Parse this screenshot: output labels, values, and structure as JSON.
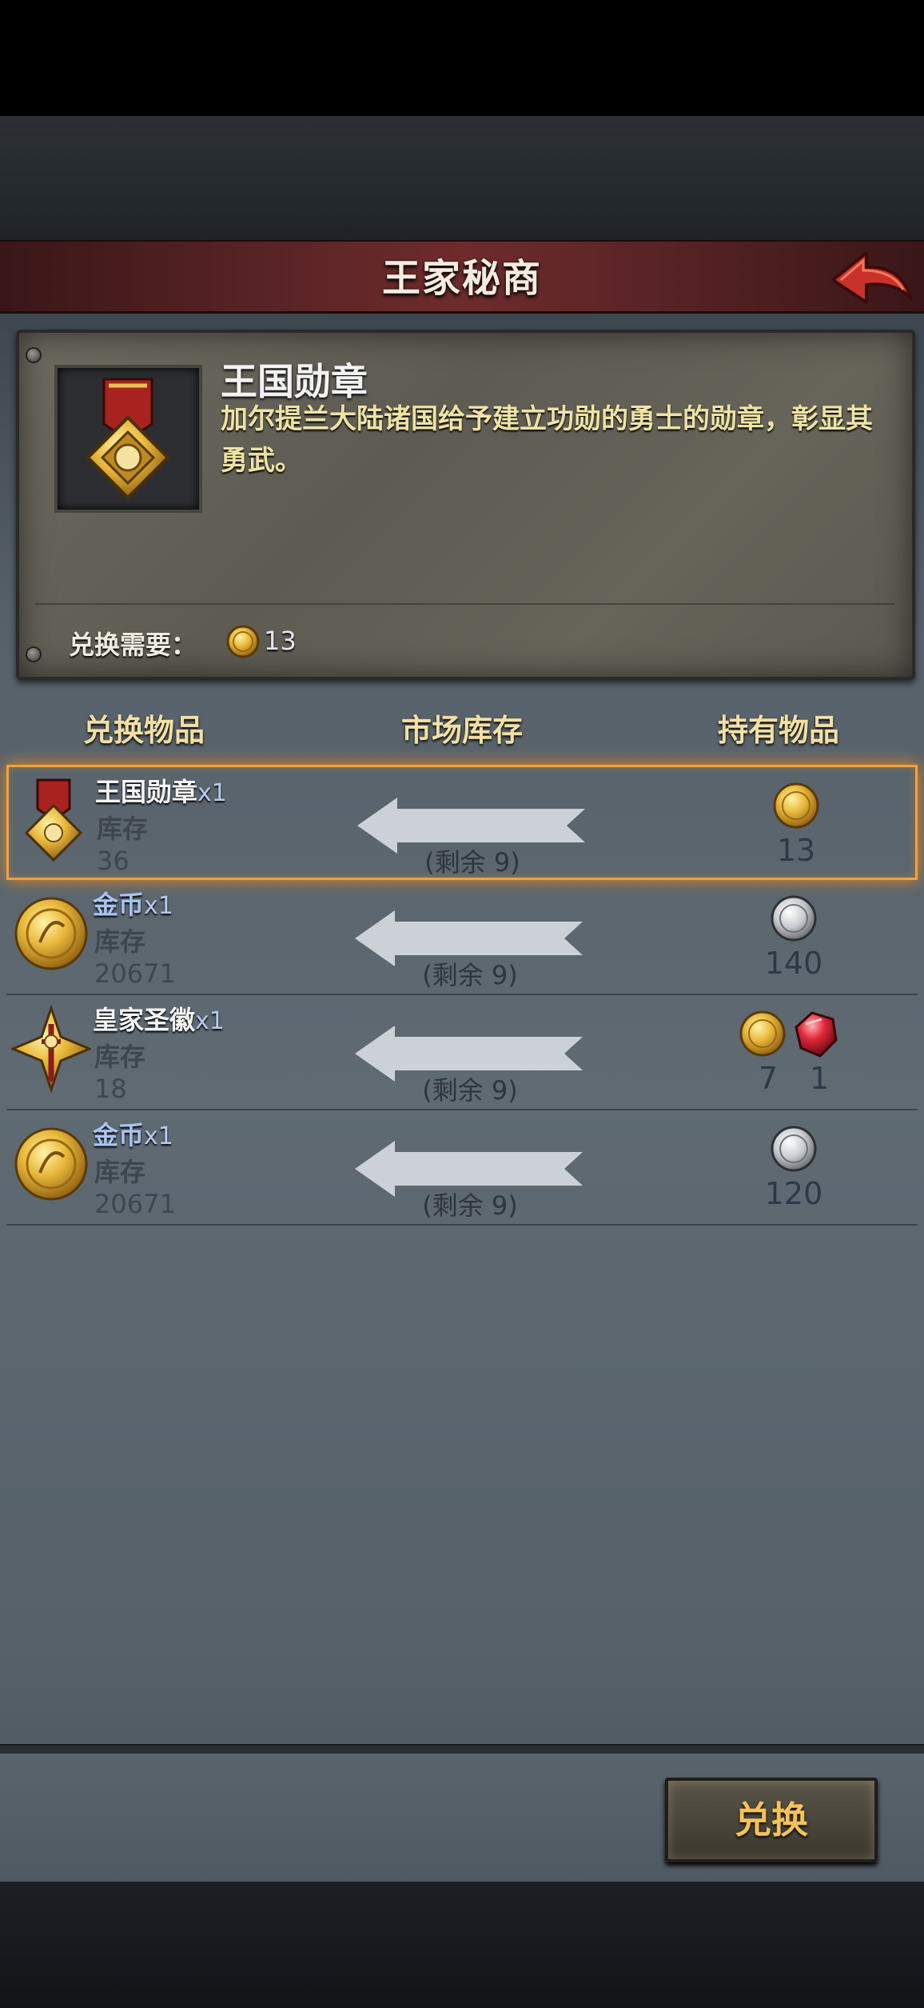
{
  "header": {
    "title": "王家秘商"
  },
  "item_detail": {
    "name": "王国勋章",
    "description": "加尔提兰大陆诸国给予建立功勋的勇士的勋章，彰显其勇武。",
    "cost_label": "兑换需要：",
    "cost_value": "13",
    "cost_icon": "gold-coin-icon"
  },
  "columns": {
    "exchange_item": "兑换物品",
    "market_stock": "市场库存",
    "owned_items": "持有物品"
  },
  "rows": [
    {
      "name": "王国勋章",
      "qty": "x1",
      "stock_label": "库存",
      "stock": "36",
      "remaining": "(剩余 9)",
      "owned": [
        "13"
      ],
      "icon": "medal-icon",
      "owned_icons": [
        "gold-coin-icon"
      ],
      "selected": true
    },
    {
      "name": "金币",
      "qty": "x1",
      "stock_label": "库存",
      "stock": "20671",
      "remaining": "(剩余 9)",
      "owned": [
        "140"
      ],
      "icon": "gold-coin-icon",
      "owned_icons": [
        "silver-coin-icon"
      ],
      "selected": false
    },
    {
      "name": "皇家圣徽",
      "qty": "x1",
      "stock_label": "库存",
      "stock": "18",
      "remaining": "(剩余 9)",
      "owned": [
        "7",
        "1"
      ],
      "icon": "holy-emblem-icon",
      "owned_icons": [
        "gold-coin-icon",
        "red-gem-icon"
      ],
      "selected": false
    },
    {
      "name": "金币",
      "qty": "x1",
      "stock_label": "库存",
      "stock": "20671",
      "remaining": "(剩余 9)",
      "owned": [
        "120"
      ],
      "icon": "gold-coin-icon",
      "owned_icons": [
        "silver-coin-icon"
      ],
      "selected": false
    }
  ],
  "footer": {
    "exchange_button": "兑换"
  },
  "colors": {
    "selected_border": "#f2a23a",
    "header_red": "#6e2b2c",
    "gold_text": "#f2e0a2",
    "button_text": "#f4c15a"
  }
}
